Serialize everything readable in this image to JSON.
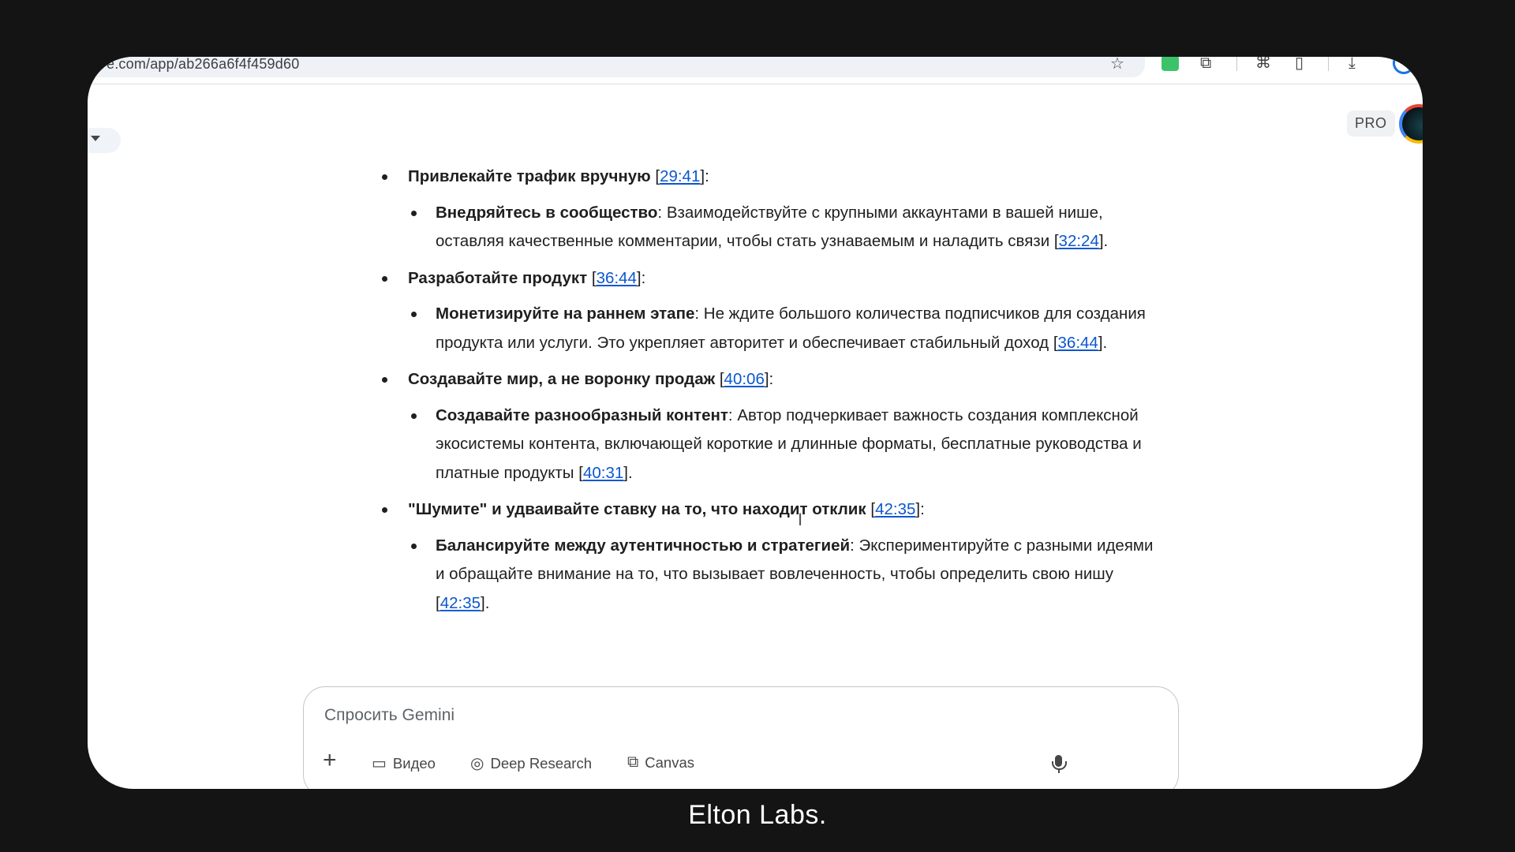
{
  "browser": {
    "url": "e.com/app/ab266a6f4f459d60"
  },
  "header": {
    "pro_badge": "PRO"
  },
  "content": {
    "sections": [
      {
        "heading": "Привлекайте трафик вручную",
        "timestamp": "29:41",
        "sub": {
          "bold": "Внедряйтесь в сообщество",
          "text": "Взаимодействуйте с крупными аккаунтами в вашей нише, оставляя качественные комментарии, чтобы стать узнаваемым и наладить связи",
          "timestamp": "32:24"
        }
      },
      {
        "heading": "Разработайте продукт",
        "timestamp": "36:44",
        "sub": {
          "bold": "Монетизируйте на раннем этапе",
          "text": "Не ждите большого количества подписчиков для создания продукта или услуги. Это укрепляет авторитет и обеспечивает стабильный доход",
          "timestamp": "36:44"
        }
      },
      {
        "heading": "Создавайте мир, а не воронку продаж",
        "timestamp": "40:06",
        "sub": {
          "bold": "Создавайте разнообразный контент",
          "text": "Автор подчеркивает важность создания комплексной экосистемы контента, включающей короткие и длинные форматы, бесплатные руководства и платные продукты",
          "timestamp": "40:31"
        }
      },
      {
        "heading": "\"Шумите\" и удваивайте ставку на то, что находит отклик",
        "timestamp": "42:35",
        "sub": {
          "bold": "Балансируйте между аутентичностью и стратегией",
          "text": "Экспериментируйте с разными идеями и обращайте внимание на то, что вызывает вовлеченность, чтобы определить свою нишу",
          "timestamp": "42:35"
        }
      }
    ]
  },
  "input": {
    "placeholder": "Спросить Gemini",
    "tools": {
      "video": "Видео",
      "deep_research": "Deep Research",
      "canvas": "Canvas"
    }
  },
  "brand": {
    "text": "Elton Labs."
  },
  "colors": {
    "link": "#0b57d0",
    "background": "#141414",
    "text": "#1f1f1f"
  }
}
